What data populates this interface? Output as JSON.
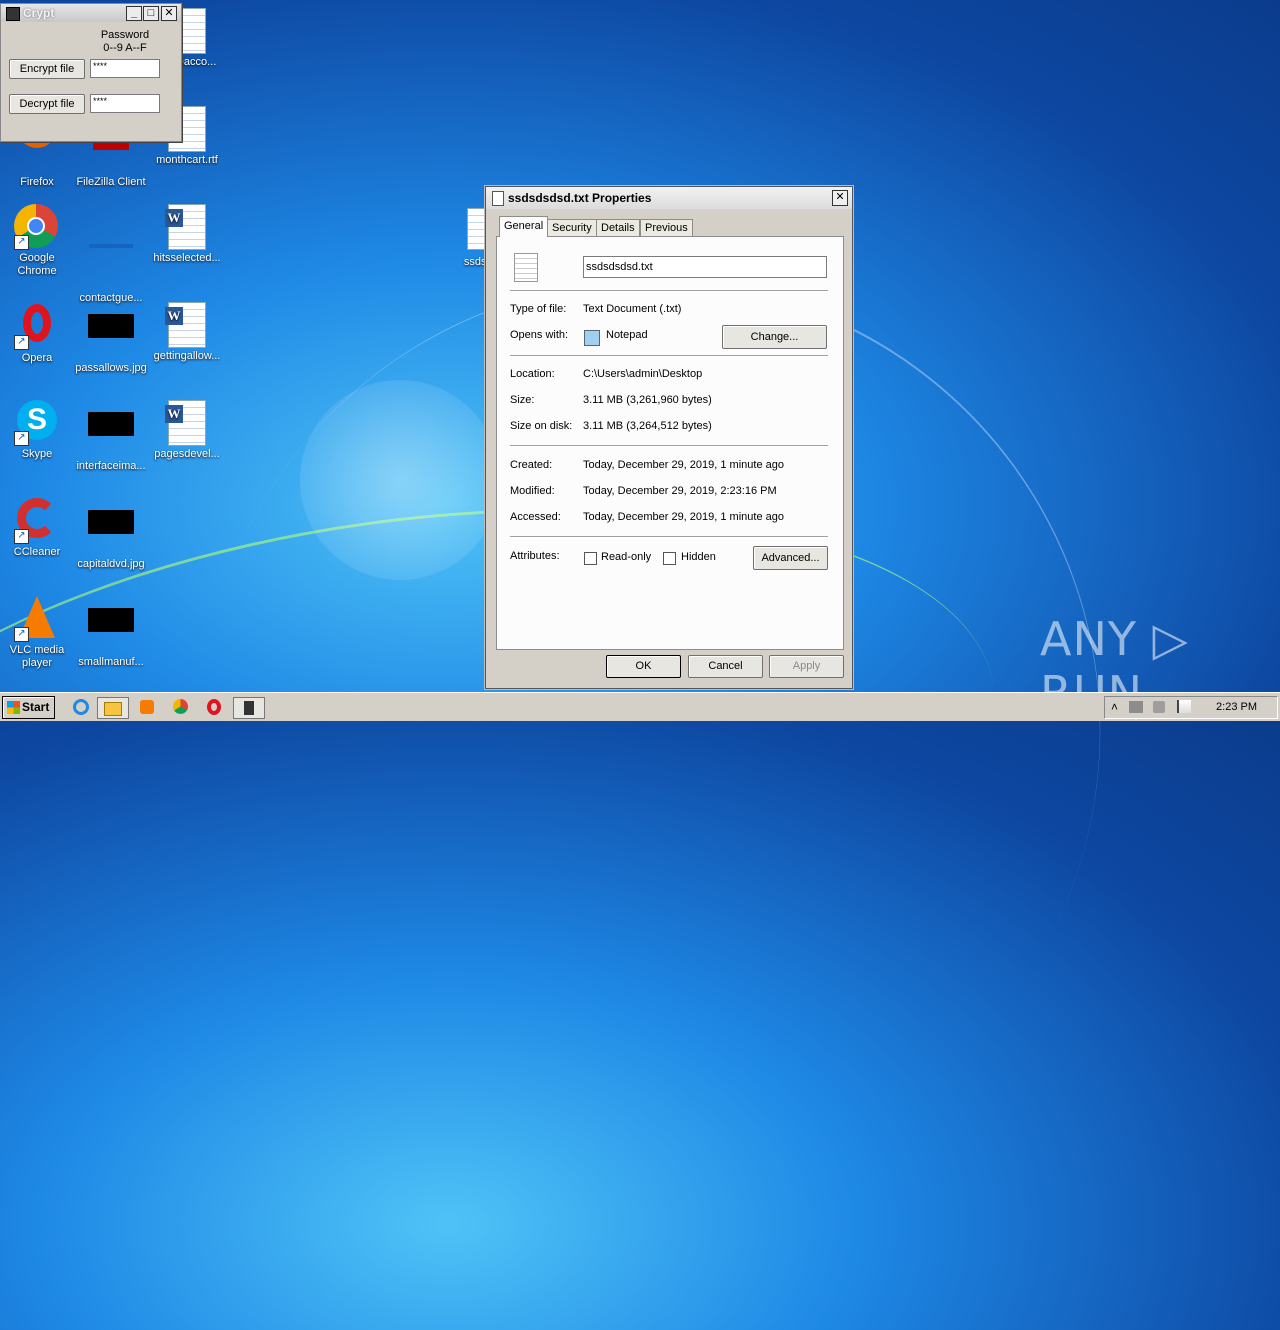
{
  "desktop": {
    "icons": [
      {
        "label": "Firefox"
      },
      {
        "label": "FileZilla Client"
      },
      {
        "label": "monthcart.rtf"
      },
      {
        "label": "Google Chrome"
      },
      {
        "label": "contactgue..."
      },
      {
        "label": "hitsselected..."
      },
      {
        "label": "Opera"
      },
      {
        "label": "passallows.jpg"
      },
      {
        "label": "gettingallow..."
      },
      {
        "label": "Skype"
      },
      {
        "label": "interfaceima..."
      },
      {
        "label": "pagesdevel..."
      },
      {
        "label": "CCleaner"
      },
      {
        "label": "capitaldvd.jpg"
      },
      {
        "label": "VLC media player"
      },
      {
        "label": "smallmanuf..."
      },
      {
        "label": "eacco..."
      },
      {
        "label": "ssdsds"
      }
    ]
  },
  "crypt": {
    "title": "Crypt",
    "password_label_1": "Password",
    "password_label_2": "0--9 A--F",
    "encrypt_label": "Encrypt file",
    "decrypt_label": "Decrypt file",
    "encrypt_value": "****",
    "decrypt_value": "****",
    "min": "_",
    "max": "□",
    "close": "✕"
  },
  "props": {
    "title": "ssdsdsdsd.txt Properties",
    "close": "✕",
    "tabs": [
      "General",
      "Security",
      "Details",
      "Previous Versions"
    ],
    "filename": "ssdsdsdsd.txt",
    "type_label": "Type of file:",
    "type_value": "Text Document (.txt)",
    "opens_label": "Opens with:",
    "opens_value": "Notepad",
    "change_label": "Change...",
    "location_label": "Location:",
    "location_value": "C:\\Users\\admin\\Desktop",
    "size_label": "Size:",
    "size_value": "3.11 MB (3,261,960 bytes)",
    "sizedisk_label": "Size on disk:",
    "sizedisk_value": "3.11 MB (3,264,512 bytes)",
    "created_label": "Created:",
    "created_value": "Today, December 29, 2019, 1 minute ago",
    "modified_label": "Modified:",
    "modified_value": "Today, December 29, 2019, 2:23:16 PM",
    "accessed_label": "Accessed:",
    "accessed_value": "Today, December 29, 2019, 1 minute ago",
    "attributes_label": "Attributes:",
    "readonly_label": "Read-only",
    "hidden_label": "Hidden",
    "advanced_label": "Advanced...",
    "ok_label": "OK",
    "cancel_label": "Cancel",
    "apply_label": "Apply"
  },
  "watermark": "ANY ▷ RUN",
  "taskbar": {
    "start_label": "Start",
    "clock": "2:23 PM",
    "tray_up": "˄"
  }
}
